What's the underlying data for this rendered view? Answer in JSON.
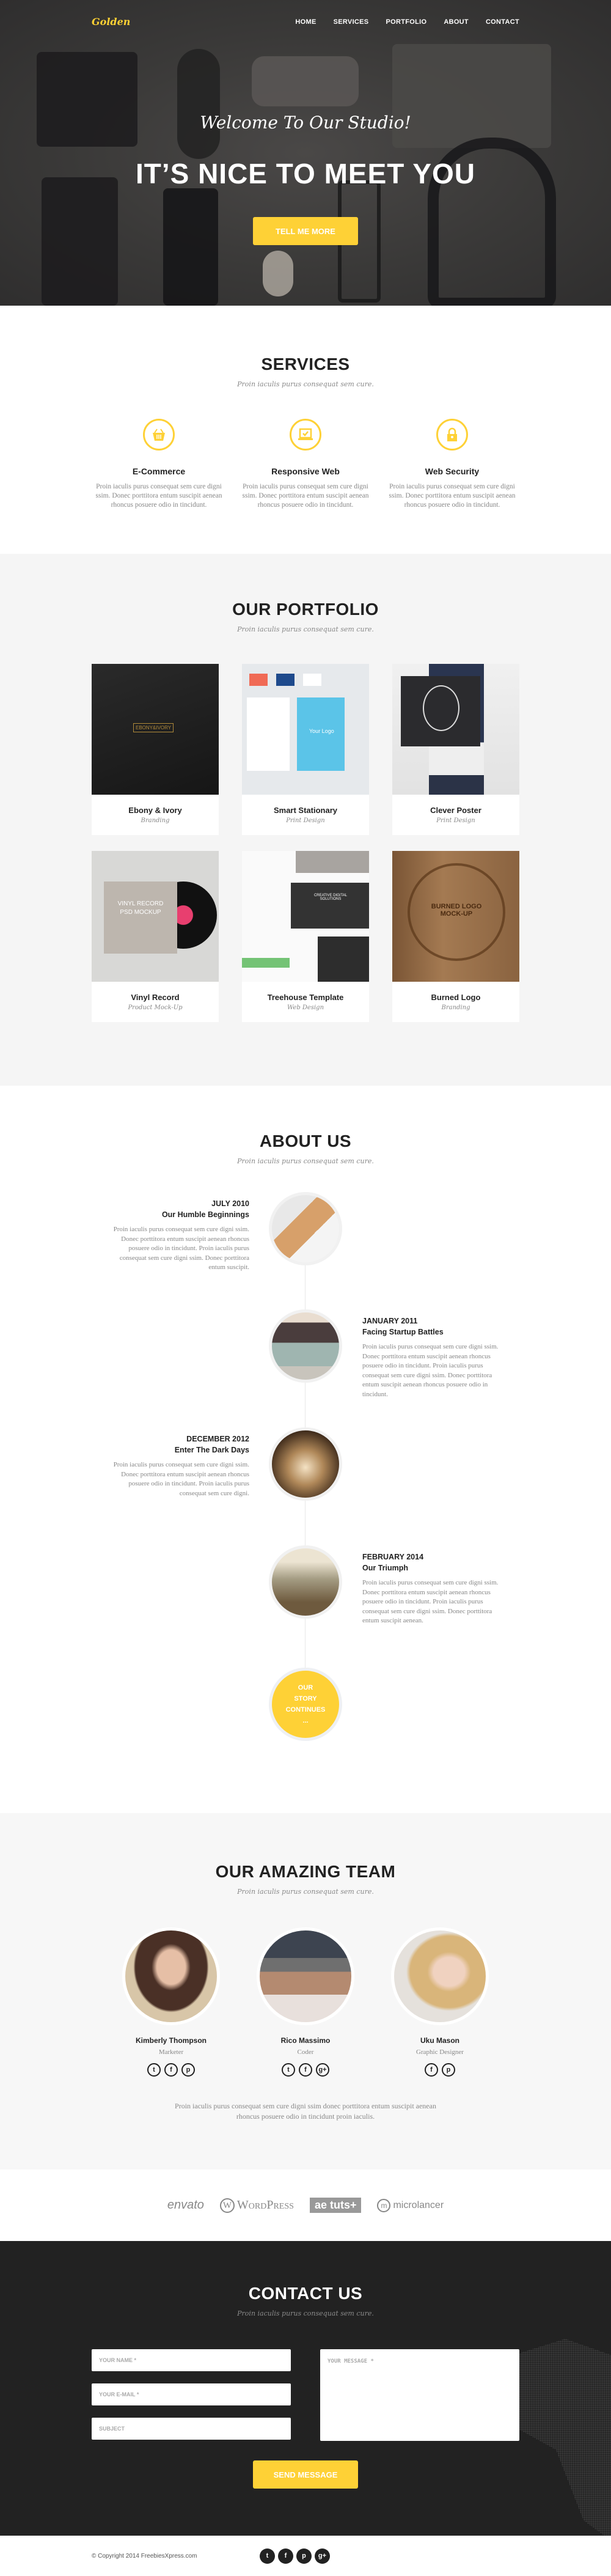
{
  "nav": {
    "logo": "Golden",
    "items": [
      "HOME",
      "SERVICES",
      "PORTFOLIO",
      "ABOUT",
      "CONTACT"
    ]
  },
  "hero": {
    "welcome": "Welcome To Our Studio!",
    "title": "IT’S NICE TO MEET YOU",
    "button": "TELL ME MORE"
  },
  "services": {
    "title": "SERVICES",
    "subtitle": "Proin iaculis purus consequat sem cure.",
    "items": [
      {
        "icon": "basket-icon",
        "title": "E-Commerce",
        "text": "Proin iaculis purus consequat sem cure digni ssim. Donec porttitora entum suscipit aenean rhoncus posuere odio in tincidunt."
      },
      {
        "icon": "laptop-check-icon",
        "title": "Responsive Web",
        "text": "Proin iaculis purus consequat sem cure digni ssim. Donec porttitora entum suscipit aenean rhoncus posuere odio in tincidunt."
      },
      {
        "icon": "lock-icon",
        "title": "Web Security",
        "text": "Proin iaculis purus consequat sem cure digni ssim. Donec porttitora entum suscipit aenean rhoncus posuere odio in tincidunt."
      }
    ]
  },
  "portfolio": {
    "title": "OUR PORTFOLIO",
    "subtitle": "Proin iaculis purus consequat sem cure.",
    "items": [
      {
        "title": "Ebony & Ivory",
        "category": "Branding",
        "image_label": "EBONY&IVORY"
      },
      {
        "title": "Smart Stationary",
        "category": "Print Design",
        "image_label": "Your Logo"
      },
      {
        "title": "Clever Poster",
        "category": "Print Design",
        "image_label": ""
      },
      {
        "title": "Vinyl Record",
        "category": "Product Mock-Up",
        "image_label": "VINYL RECORD PSD MOCKUP"
      },
      {
        "title": "Treehouse Template",
        "category": "Web Design",
        "image_label": "CREATIVE DIGITAL SOLUTIONS"
      },
      {
        "title": "Burned Logo",
        "category": "Branding",
        "image_label": "BURNED LOGO MOCK-UP"
      }
    ]
  },
  "about": {
    "title": "ABOUT US",
    "subtitle": "Proin iaculis purus consequat sem cure.",
    "timeline": [
      {
        "date": "JULY 2010",
        "heading": "Our Humble Beginnings",
        "text": "Proin iaculis purus consequat sem cure digni ssim. Donec porttitora entum suscipit aenean rhoncus posuere odio in tincidunt. Proin iaculis purus consequat sem cure digni ssim. Donec porttitora entum suscipit."
      },
      {
        "date": "JANUARY 2011",
        "heading": "Facing Startup Battles",
        "text": "Proin iaculis purus consequat sem cure digni ssim. Donec porttitora entum suscipit aenean rhoncus posuere odio in tincidunt. Proin iaculis purus consequat sem cure digni ssim. Donec porttitora entum suscipit aenean rhoncus posuere odio in tincidunt."
      },
      {
        "date": "DECEMBER 2012",
        "heading": "Enter The Dark Days",
        "text": "Proin iaculis purus consequat sem cure digni ssim. Donec porttitora entum suscipit aenean rhoncus posuere odio in tincidunt. Proin iaculis purus consequat sem cure digni."
      },
      {
        "date": "FEBRUARY 2014",
        "heading": "Our Triumph",
        "text": "Proin iaculis purus consequat sem cure digni ssim. Donec porttitora entum suscipit aenean rhoncus posuere odio in tincidunt. Proin iaculis purus consequat sem cure digni ssim. Donec porttitora entum suscipit aenean."
      }
    ],
    "end_lines": [
      "OUR",
      "STORY",
      "CONTINUES",
      "..."
    ]
  },
  "team": {
    "title": "OUR AMAZING TEAM",
    "subtitle": "Proin iaculis purus consequat sem cure.",
    "members": [
      {
        "name": "Kimberly Thompson",
        "role": "Marketer",
        "socials": [
          "twitter",
          "facebook",
          "pinterest"
        ]
      },
      {
        "name": "Rico Massimo",
        "role": "Coder",
        "socials": [
          "twitter",
          "facebook",
          "google-plus"
        ]
      },
      {
        "name": "Uku Mason",
        "role": "Graphic Designer",
        "socials": [
          "facebook",
          "pinterest"
        ]
      }
    ],
    "note": "Proin iaculis purus consequat sem cure  digni ssim donec porttitora entum suscipit aenean rhoncus posuere odio in tincidunt proin iaculis."
  },
  "clients": [
    "envato",
    "WordPress",
    "ae tuts+",
    "microlancer"
  ],
  "contact": {
    "title": "CONTACT US",
    "subtitle": "Proin iaculis purus consequat sem cure.",
    "name_placeholder": "YOUR NAME *",
    "email_placeholder": "YOUR E-MAIL *",
    "subject_placeholder": "SUBJECT",
    "message_placeholder": "YOUR MESSAGE *",
    "button": "SEND MESSAGE"
  },
  "footer": {
    "copyright": "© Copyright 2014 FreebiesXpress.com",
    "socials": [
      "twitter",
      "facebook",
      "pinterest",
      "google-plus"
    ]
  },
  "colors": {
    "accent": "#fed136",
    "dark": "#222222",
    "light_bg": "#f5f5f5"
  }
}
